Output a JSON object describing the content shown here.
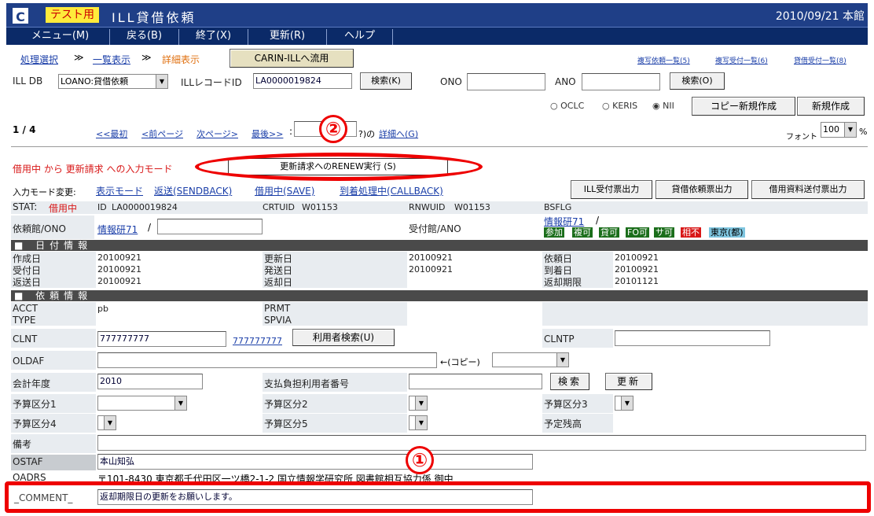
{
  "app": {
    "test_tag": "テスト用",
    "title": "ILL貸借依頼",
    "date_location": "2010/09/21 本館",
    "logo": "C"
  },
  "menu": [
    "メニュー(M)",
    "戻る(B)",
    "終了(X)",
    "更新(R)",
    "ヘルプ"
  ],
  "breadcrumb": {
    "step1": "処理選択",
    "sep": "≫",
    "step2": "一覧表示",
    "step3": "詳細表示",
    "carin_button": "CARIN-ILLへ流用"
  },
  "toplinks": [
    "複写依頼一覧(5)",
    "複写受付一覧(6)",
    "貸借受付一覧(8)"
  ],
  "search": {
    "ill_db_label": "ILL DB",
    "ill_db_value": "LOANO:貸借依頼",
    "ill_record_label": "ILLレコードID",
    "ill_record_value": "LA0000019824",
    "search_k": "検索(K)",
    "ono_label": "ONO",
    "ano_label": "ANO",
    "search_o": "検索(O)"
  },
  "radios": {
    "oclc": "OCLC",
    "keris": "KERIS",
    "nii": "NII",
    "selected": "NII"
  },
  "actions": {
    "copy_new": "コピー新規作成",
    "new": "新規作成"
  },
  "paging": {
    "page": "1 / 4",
    "first": "<<最初",
    "prev": "<前ページ",
    "next": "次ページ>",
    "last": "最後>>",
    "colon": ":",
    "of_suffix": "?)の",
    "detail": "詳細へ(G)",
    "font_label": "フォント",
    "font_value": "100",
    "percent": "%"
  },
  "mode": {
    "status_text": "借用中 から 更新請求 への入力モード",
    "renew_button": "更新請求へのRENEW実行 (S)",
    "change_label": "入力モード変更:",
    "links": [
      "表示モード",
      "返送(SENDBACK)",
      "借用中(SAVE)",
      "到着処理中(CALLBACK)"
    ]
  },
  "print_buttons": [
    "ILL受付票出力",
    "貸借依頼票出力",
    "借用資料送付票出力"
  ],
  "record": {
    "stat_label": "STAT:",
    "stat_value": "借用中",
    "id_label": "ID",
    "id_value": "LA0000019824",
    "crtuid_label": "CRTUID",
    "crtuid_value": "W01153",
    "rnwuid_label": "RNWUID",
    "rnwuid_value": "W01153",
    "bsflg_label": "BSFLG",
    "req_lib_label": "依頼館/ONO",
    "req_lib_link": "情報研71",
    "slash": "/",
    "rcv_lib_label": "受付館/ANO",
    "rcv_lib_link": "情報研71",
    "rcv_slash": "/",
    "tags": [
      {
        "text": "参加",
        "bg": "#1b6e1b",
        "color": "#ffffff"
      },
      {
        "text": "複可",
        "bg": "#1b6e1b",
        "color": "#ffffff"
      },
      {
        "text": "貸可",
        "bg": "#1b6e1b",
        "color": "#ffffff"
      },
      {
        "text": "FO可",
        "bg": "#1b6e1b",
        "color": "#ffffff"
      },
      {
        "text": "サ可",
        "bg": "#1b6e1b",
        "color": "#ffffff"
      },
      {
        "text": "相不",
        "bg": "#d81818",
        "color": "#ffffff"
      },
      {
        "text": "東京(都)",
        "bg": "#7fc6e0",
        "color": "#000000"
      }
    ]
  },
  "date_section": {
    "title": "日付情報",
    "rows": [
      {
        "l1": "作成日",
        "v1": "20100921",
        "l2": "更新日",
        "v2": "20100921",
        "l3": "依頼日",
        "v3": "20100921"
      },
      {
        "l1": "受付日",
        "v1": "20100921",
        "l2": "発送日",
        "v2": "20100921",
        "l3": "到着日",
        "v3": "20100921"
      },
      {
        "l1": "返送日",
        "v1": "20100921",
        "l2": "返却日",
        "v2": "",
        "l3": "返却期限",
        "v3": "20101121"
      }
    ]
  },
  "request_section": {
    "title": "依頼情報",
    "acct_label": "ACCT",
    "acct_value": "pb",
    "prmt_label": "PRMT",
    "type_label": "TYPE",
    "spvia_label": "SPVIA",
    "clnt_label": "CLNT",
    "clnt_value": "777777777",
    "clnt_link": "777777777",
    "user_search": "利用者検索(U)",
    "clntp_label": "CLNTP",
    "oldaf_label": "OLDAF",
    "copy_label": "←(コピー)",
    "fiscal_label": "会計年度",
    "fiscal_value": "2010",
    "payer_label": "支払負担利用者番号",
    "search_btn": "検索",
    "update_btn": "更新",
    "budget1": "予算区分1",
    "budget2": "予算区分2",
    "budget3": "予算区分3",
    "budget4": "予算区分4",
    "budget5": "予算区分5",
    "remaining": "予定残高",
    "remarks_label": "備考",
    "ostaf_label": "OSTAF",
    "ostaf_value": "本山知弘",
    "oadrs_label": "OADRS",
    "oadrs_value": "〒101-8430 東京都千代田区一ツ橋2-1-2 国立情報学研究所 図書館相互協力係 御中",
    "comment_label": "_COMMENT_",
    "comment_value": "返却期限日の更新をお願いします。"
  },
  "annotations": {
    "one": "①",
    "two": "②"
  }
}
